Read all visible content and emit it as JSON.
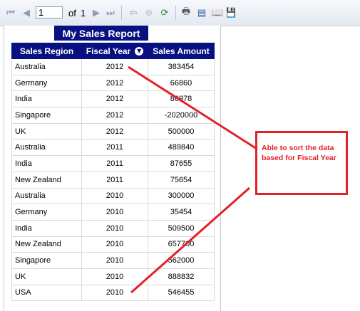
{
  "toolbar": {
    "page_value": "1",
    "of_label": "of",
    "total_pages": "1",
    "icons": [
      "first-page-icon",
      "previous-page-icon",
      "next-page-icon",
      "last-page-icon",
      "back-icon",
      "stop-icon",
      "refresh-icon",
      "print-icon",
      "print-layout-icon",
      "page-setup-icon",
      "export-icon"
    ]
  },
  "report": {
    "title": "My Sales Report",
    "columns": [
      "Sales Region",
      "Fiscal Year",
      "Sales Amount"
    ],
    "rows": [
      [
        "Australia",
        "2012",
        "383454"
      ],
      [
        "Germany",
        "2012",
        "66860"
      ],
      [
        "India",
        "2012",
        "86978"
      ],
      [
        "Singapore",
        "2012",
        "-2020000"
      ],
      [
        "UK",
        "2012",
        "500000"
      ],
      [
        "Australia",
        "2011",
        "489840"
      ],
      [
        "India",
        "2011",
        "87655"
      ],
      [
        "New Zealand",
        "2011",
        "75654"
      ],
      [
        "Australia",
        "2010",
        "300000"
      ],
      [
        "Germany",
        "2010",
        "35454"
      ],
      [
        "India",
        "2010",
        "509500"
      ],
      [
        "New Zealand",
        "2010",
        "657700"
      ],
      [
        "Singapore",
        "2010",
        "562000"
      ],
      [
        "UK",
        "2010",
        "888832"
      ],
      [
        "USA",
        "2010",
        "546455"
      ]
    ]
  },
  "annotation": {
    "text": "Able to sort the data based for Fiscal Year",
    "color": "#e32127"
  },
  "colors": {
    "header_bg": "#081181",
    "accent_red": "#e32127"
  }
}
